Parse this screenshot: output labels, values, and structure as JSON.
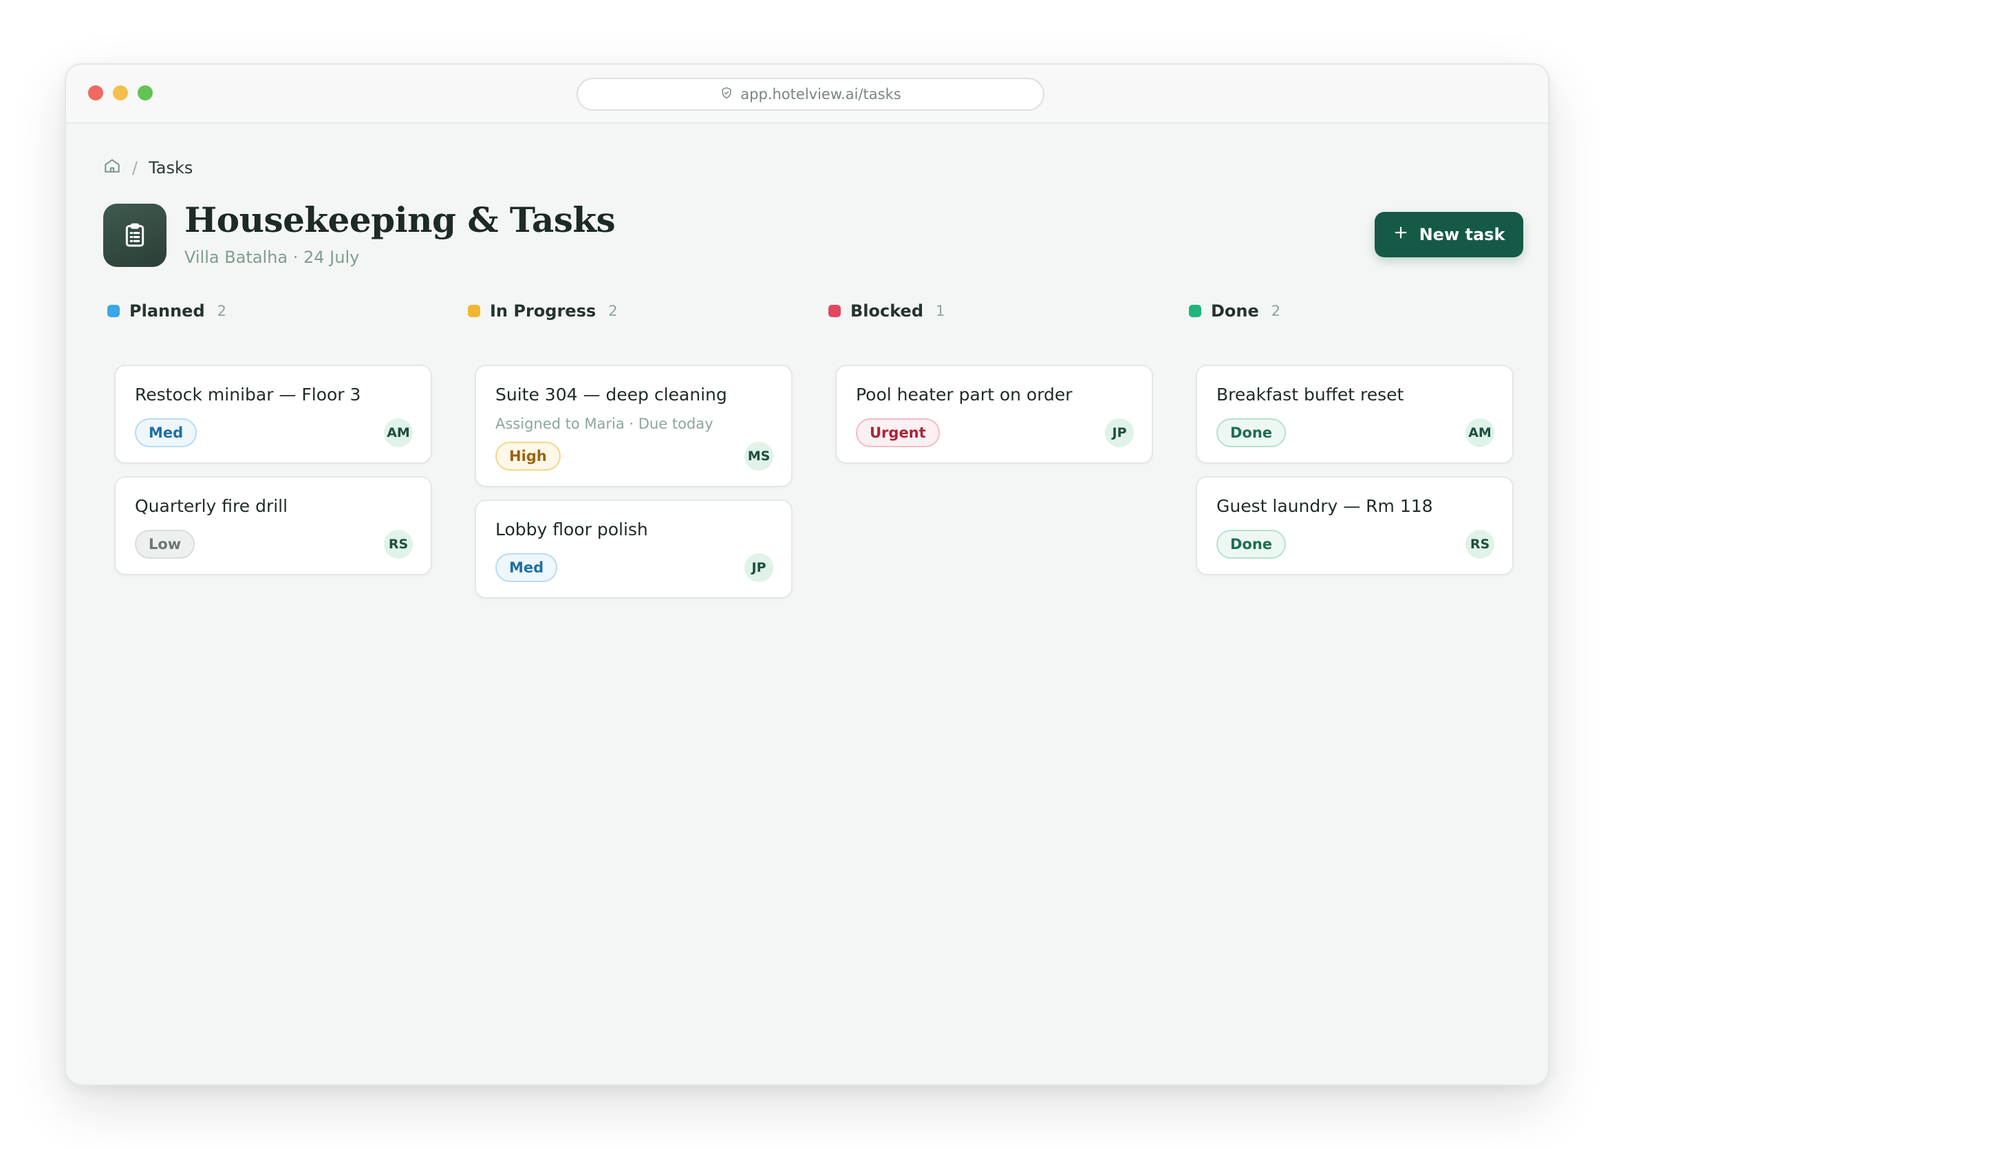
{
  "browser": {
    "url": "app.hotelview.ai/tasks"
  },
  "breadcrumb": {
    "current": "Tasks",
    "separator": "/"
  },
  "header": {
    "title": "Housekeeping & Tasks",
    "subtitle": "Villa Batalha · 24 July",
    "new_task_label": "New task"
  },
  "columns": [
    {
      "title": "Planned",
      "count": "2",
      "color": "#3aa6e8",
      "cards": [
        {
          "title": "Restock minibar — Floor 3",
          "badge": "Med",
          "avatar": "AM"
        },
        {
          "title": "Quarterly fire drill",
          "badge": "Low",
          "avatar": "RS"
        }
      ]
    },
    {
      "title": "In Progress",
      "count": "2",
      "color": "#f2b632",
      "cards": [
        {
          "title": "Suite 304 — deep cleaning",
          "sub": "Assigned to Maria · Due today",
          "badge": "High",
          "avatar": "MS"
        },
        {
          "title": "Lobby floor polish",
          "badge": "Med",
          "avatar": "JP"
        }
      ]
    },
    {
      "title": "Blocked",
      "count": "1",
      "color": "#e5455e",
      "cards": [
        {
          "title": "Pool heater part on order",
          "badge": "Urgent",
          "avatar": "JP"
        }
      ]
    },
    {
      "title": "Done",
      "count": "2",
      "color": "#1fb57a",
      "cards": [
        {
          "title": "Breakfast buffet reset",
          "badge": "Done",
          "avatar": "AM"
        },
        {
          "title": "Guest laundry — Rm 118",
          "badge": "Done",
          "avatar": "RS"
        }
      ]
    }
  ]
}
